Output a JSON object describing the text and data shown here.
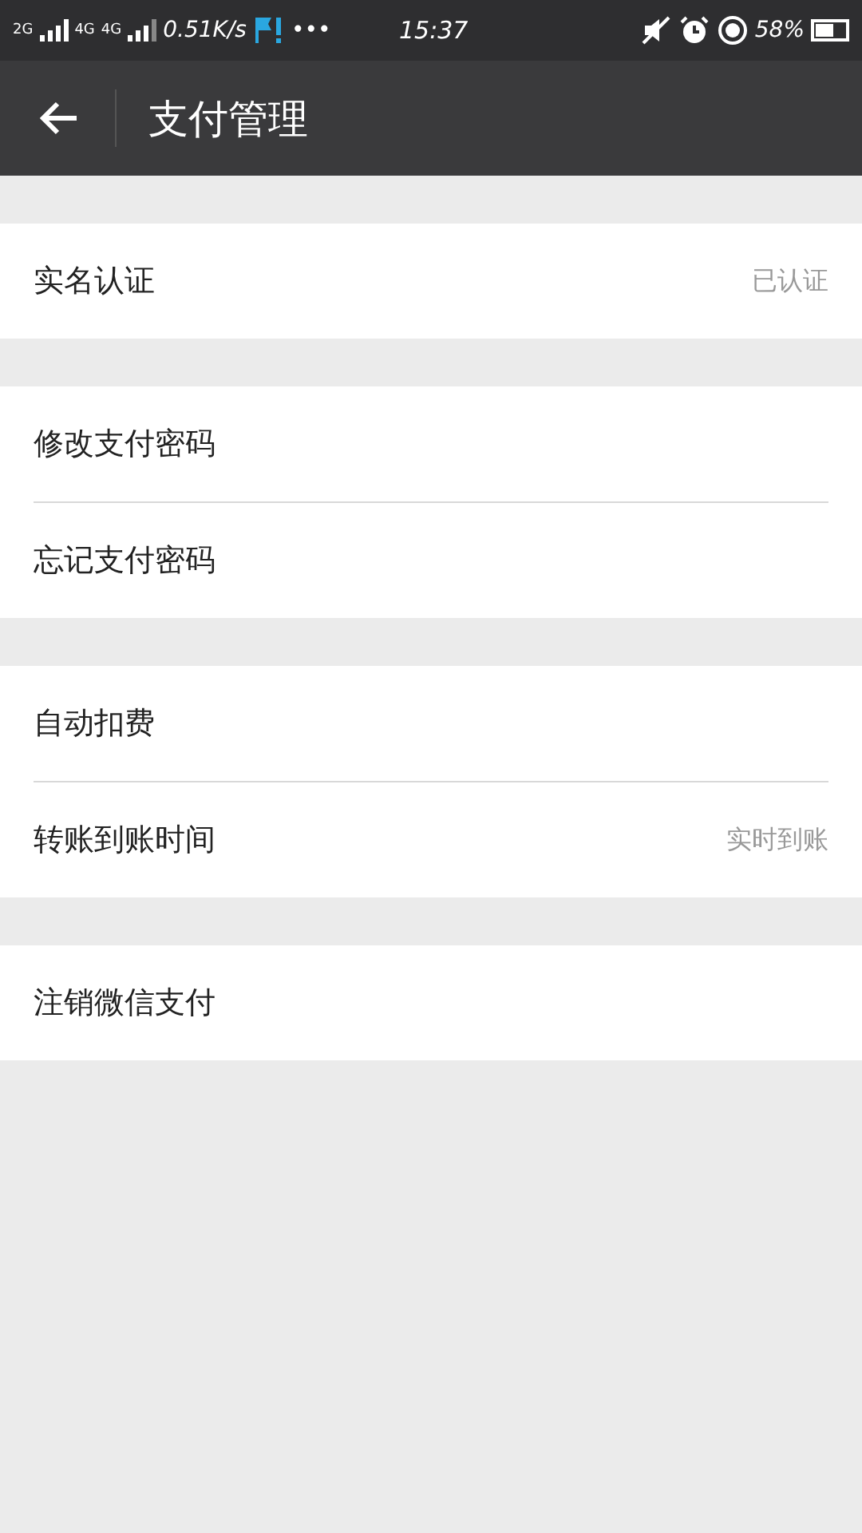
{
  "status_bar": {
    "network_labels": [
      "2G",
      "4G",
      "4G"
    ],
    "speed": "0.51K/s",
    "more": "•••",
    "time": "15:37",
    "battery_percent": "58%"
  },
  "header": {
    "title": "支付管理"
  },
  "groups": [
    {
      "items": [
        {
          "label": "实名认证",
          "value": "已认证"
        }
      ]
    },
    {
      "items": [
        {
          "label": "修改支付密码"
        },
        {
          "label": "忘记支付密码"
        }
      ]
    },
    {
      "items": [
        {
          "label": "自动扣费"
        },
        {
          "label": "转账到账时间",
          "value": "实时到账"
        }
      ]
    },
    {
      "items": [
        {
          "label": "注销微信支付"
        }
      ]
    }
  ]
}
